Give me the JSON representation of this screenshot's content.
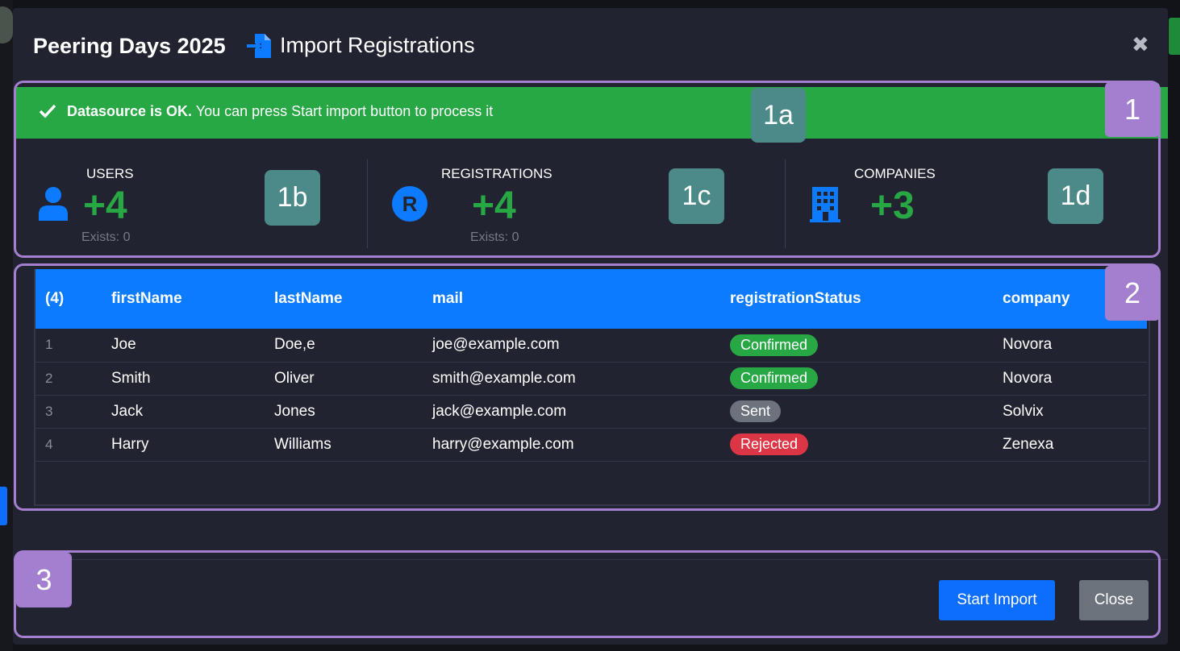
{
  "header": {
    "event_title": "Peering Days 2025",
    "dialog_title": "Import Registrations",
    "close_symbol": "✖"
  },
  "alert": {
    "bold_text": "Datasource is OK.",
    "text": " You can press Start import button to process it",
    "color": "#28a745"
  },
  "stats": {
    "users": {
      "label": "USERS",
      "value": "+4",
      "exists": "Exists: 0",
      "icon": "user-icon"
    },
    "registrations": {
      "label": "REGISTRATIONS",
      "value": "+4",
      "exists": "Exists: 0",
      "icon": "registered-icon"
    },
    "companies": {
      "label": "COMPANIES",
      "value": "+3",
      "icon": "building-icon"
    }
  },
  "table": {
    "headers": [
      "(4)",
      "firstName",
      "lastName",
      "mail",
      "registrationStatus",
      "company"
    ],
    "rows": [
      {
        "n": "1",
        "first": "Joe",
        "last": "Doe,e",
        "mail": "joe@example.com",
        "status": "Confirmed",
        "status_color": "#28a745",
        "company": "Novora"
      },
      {
        "n": "2",
        "first": "Smith",
        "last": "Oliver",
        "mail": "smith@example.com",
        "status": "Confirmed",
        "status_color": "#28a745",
        "company": "Novora"
      },
      {
        "n": "3",
        "first": "Jack",
        "last": "Jones",
        "mail": "jack@example.com",
        "status": "Sent",
        "status_color": "#6c737d",
        "company": "Solvix"
      },
      {
        "n": "4",
        "first": "Harry",
        "last": "Williams",
        "mail": "harry@example.com",
        "status": "Rejected",
        "status_color": "#dc3545",
        "company": "Zenexa"
      }
    ]
  },
  "footer": {
    "start_label": "Start Import",
    "close_label": "Close"
  },
  "annotations": {
    "a1": "1",
    "a1a": "1a",
    "a1b": "1b",
    "a1c": "1c",
    "a1d": "1d",
    "a2": "2",
    "a3": "3"
  },
  "colors": {
    "accent": "#0d7bff",
    "success": "#28a745",
    "annotation": "#a47fcf",
    "annotation_teal": "#4b8a88"
  }
}
